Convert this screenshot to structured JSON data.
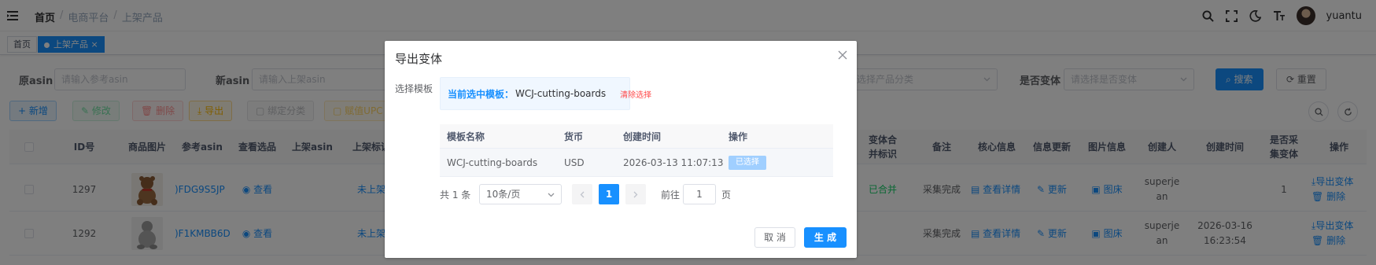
{
  "breadcrumb": [
    "首页",
    "电商平台",
    "上架产品"
  ],
  "breadcrumb_sep": "/",
  "user": {
    "name": "yuantu"
  },
  "tabs": [
    {
      "label": "首页"
    },
    {
      "label": "上架产品",
      "close": "×"
    }
  ],
  "search": {
    "ref_asin": {
      "label": "原asin",
      "placeholder": "请输入参考asin"
    },
    "new_asin": {
      "label": "新asin",
      "placeholder": "请输入上架asin"
    },
    "category": {
      "placeholder": "选择产品分类"
    },
    "is_variant": {
      "label": "是否变体",
      "placeholder": "请选择是否变体"
    },
    "search_btn": "搜索",
    "reset_btn": "重置"
  },
  "toolbar": {
    "add": "新增",
    "edit": "修改",
    "delete": "删除",
    "export": "导出",
    "bind": "绑定分类",
    "assign": "赋值UPC"
  },
  "table": {
    "headers": {
      "id": "ID号",
      "image": "商品图片",
      "ref_asin": "参考asin",
      "view_sel": "查看选品",
      "up_asin": "上架asin",
      "up_flag": "上架标识",
      "variant_merge": "变体合并标识",
      "remark": "备注",
      "core": "核心信息",
      "update": "信息更新",
      "img_info": "图片信息",
      "creator": "创建人",
      "ctime": "创建时间",
      "is_collect": "是否采集变体",
      "ops": "操作"
    },
    "rows": [
      {
        "id": "1297",
        "ref_asin": ")FDG9S5JP",
        "view": "查看",
        "up_flag": "未上架",
        "merge": "已合并",
        "remark": "采集完成",
        "core": "查看详情",
        "update": "更新",
        "img": "图床",
        "creator": "superjean",
        "ctime_date": "",
        "ctime_time": "",
        "collect": "1",
        "op_export": "导出变体",
        "op_delete": "删除"
      },
      {
        "id": "1292",
        "ref_asin": ")F1KMBB6D",
        "view": "查看",
        "up_flag": "未上架",
        "merge": "",
        "remark": "采集完成",
        "core": "查看详情",
        "update": "更新",
        "img": "图床",
        "creator": "superjean",
        "ctime_date": "2026-03-16",
        "ctime_time": "16:23:54",
        "collect": "",
        "op_export": "导出变体",
        "op_delete": "删除"
      }
    ]
  },
  "dialog": {
    "title": "导出变体",
    "field_label": "选择模板",
    "current_key": "当前选中模板：",
    "current_value": "WCJ-cutting-boards",
    "clear": "清除选择",
    "headers": {
      "name": "模板名称",
      "currency": "货币",
      "ctime": "创建时间",
      "op": "操作"
    },
    "rows": [
      {
        "name": "WCJ-cutting-boards",
        "currency": "USD",
        "ctime": "2026-03-13 11:07:13",
        "op": "已选择"
      }
    ],
    "pager": {
      "total": "共 1 条",
      "size": "10条/页",
      "page": "1",
      "goto": "前往",
      "goto_value": "1",
      "unit": "页"
    },
    "cancel": "取 消",
    "confirm": "生 成"
  }
}
